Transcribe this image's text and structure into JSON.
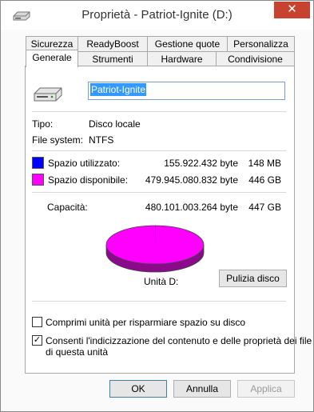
{
  "window": {
    "title": "Proprietà - Patriot-Ignite (D:)",
    "close_glyph": "✕"
  },
  "tabs": {
    "row1": [
      "Sicurezza",
      "ReadyBoost",
      "Gestione quote",
      "Personalizza"
    ],
    "row2": [
      "Generale",
      "Strumenti",
      "Hardware",
      "Condivisione"
    ],
    "active": "Generale"
  },
  "general": {
    "drive_name": "Patriot-Ignite",
    "type_label": "Tipo:",
    "type_value": "Disco locale",
    "fs_label": "File system:",
    "fs_value": "NTFS",
    "used_label": "Spazio utilizzato:",
    "used_bytes": "155.922.432 byte",
    "used_size": "148 MB",
    "free_label": "Spazio disponibile:",
    "free_bytes": "479.945.080.832 byte",
    "free_size": "446 GB",
    "capacity_label": "Capacità:",
    "capacity_bytes": "480.101.003.264 byte",
    "capacity_size": "447 GB",
    "drive_letter_label": "Unità D:",
    "cleanup_button": "Pulizia disco",
    "compress_label": "Comprimi unità per risparmiare spazio su disco",
    "compress_checked": false,
    "index_label_line1": "Consenti l'indicizzazione del contenuto e delle proprietà dei file",
    "index_label_line2": "di questa unità",
    "index_checked": true,
    "check_glyph": "✓"
  },
  "usage": {
    "used_fraction": 0.000325,
    "used_color": "#0000ff",
    "free_color": "#ff00ff",
    "free_shadow_color": "#8b0a8b"
  },
  "buttons": {
    "ok": "OK",
    "cancel": "Annulla",
    "apply": "Applica"
  },
  "icons": {
    "title": "drive-icon",
    "drive": "hard-drive-icon"
  }
}
